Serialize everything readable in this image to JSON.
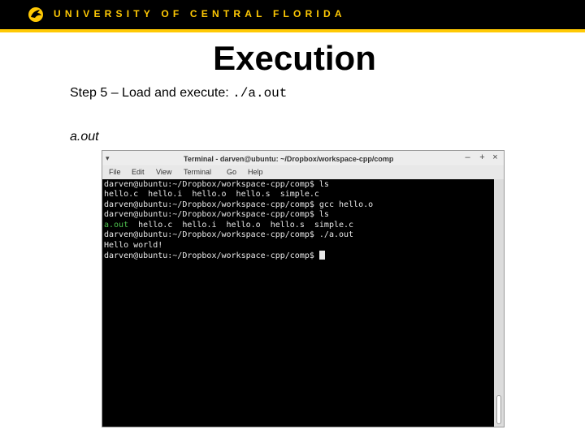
{
  "header": {
    "university_name": "UNIVERSITY OF CENTRAL FLORIDA",
    "logo_icon": "pegasus-logo-icon",
    "brand_color": "#ffc904"
  },
  "slide": {
    "title": "Execution",
    "step_text": "Step 5 – Load and execute: ",
    "step_code": "./a.out",
    "aout_label": "a.out"
  },
  "terminal": {
    "window_title": "Terminal - darven@ubuntu: ~/Dropbox/workspace-cpp/comp",
    "menu": [
      "File",
      "Edit",
      "View",
      "Terminal",
      "Go",
      "Help"
    ],
    "controls": {
      "minimize": "–",
      "maximize": "+",
      "close": "×"
    },
    "lines": [
      {
        "prompt": "darven@ubuntu:~/Dropbox/workspace-cpp/comp$ ",
        "command": "ls"
      },
      {
        "output": "hello.c  hello.i  hello.o  hello.s  simple.c"
      },
      {
        "prompt": "darven@ubuntu:~/Dropbox/workspace-cpp/comp$ ",
        "command": "gcc hello.o"
      },
      {
        "prompt": "darven@ubuntu:~/Dropbox/workspace-cpp/comp$ ",
        "command": "ls"
      },
      {
        "highlight": "a.out",
        "output": "  hello.c  hello.i  hello.o  hello.s  simple.c"
      },
      {
        "prompt": "darven@ubuntu:~/Dropbox/workspace-cpp/comp$ ",
        "command": "./a.out"
      },
      {
        "output": "Hello world!"
      },
      {
        "prompt": "darven@ubuntu:~/Dropbox/workspace-cpp/comp$ "
      }
    ]
  }
}
